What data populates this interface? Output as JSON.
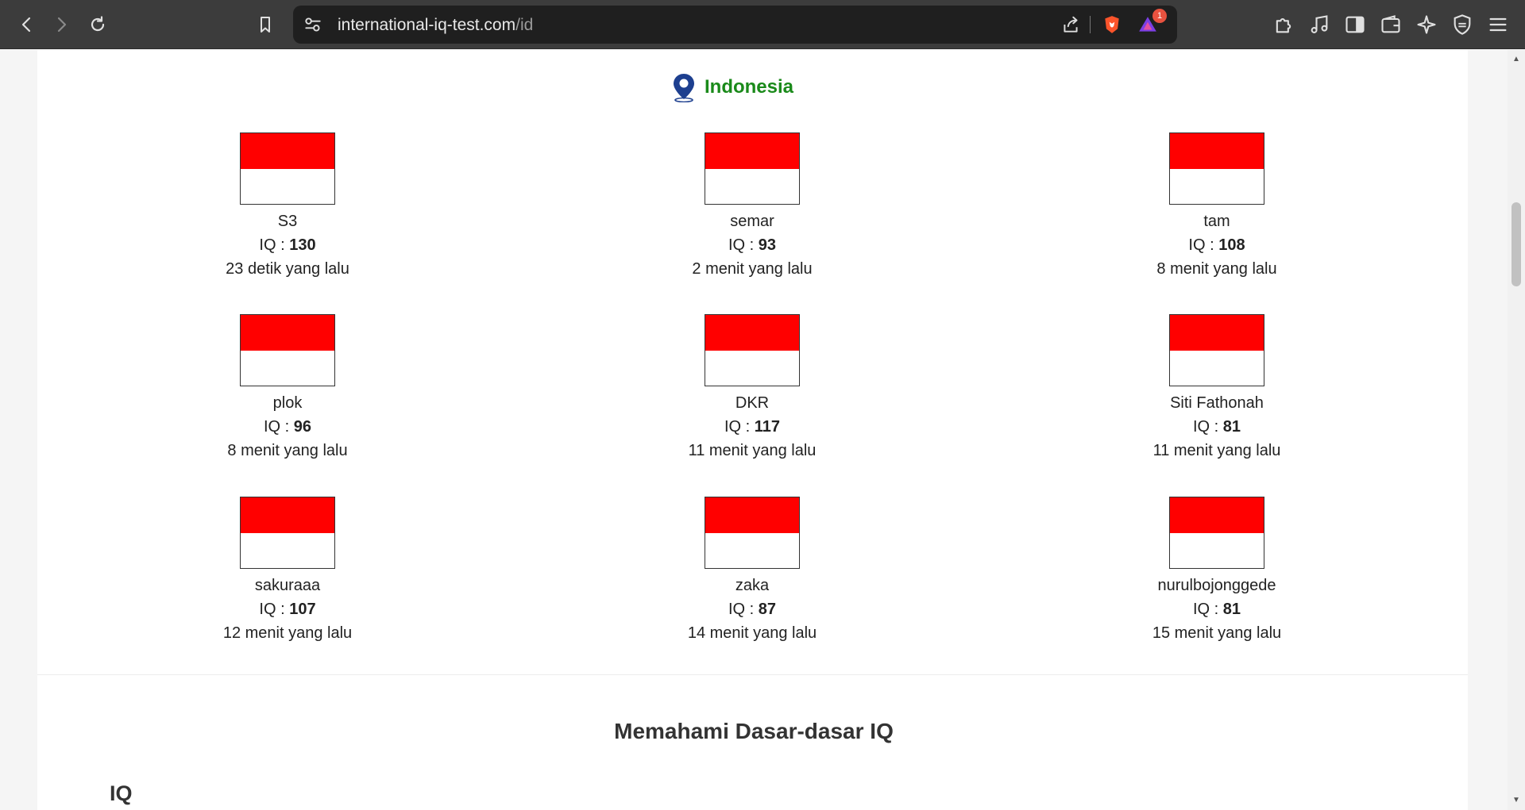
{
  "browser": {
    "url_host": "international-iq-test.com",
    "url_path": "/id",
    "notification_count": "1"
  },
  "country": {
    "label": "Indonesia",
    "icon": "map-pin-icon"
  },
  "entries": [
    {
      "name": "S3",
      "iq_prefix": "IQ : ",
      "iq": "130",
      "time": "23 detik yang lalu"
    },
    {
      "name": "semar",
      "iq_prefix": "IQ : ",
      "iq": "93",
      "time": "2 menit yang lalu"
    },
    {
      "name": "tam",
      "iq_prefix": "IQ : ",
      "iq": "108",
      "time": "8 menit yang lalu"
    },
    {
      "name": "plok",
      "iq_prefix": "IQ : ",
      "iq": "96",
      "time": "8 menit yang lalu"
    },
    {
      "name": "DKR",
      "iq_prefix": "IQ : ",
      "iq": "117",
      "time": "11 menit yang lalu"
    },
    {
      "name": "Siti Fathonah",
      "iq_prefix": "IQ : ",
      "iq": "81",
      "time": "11 menit yang lalu"
    },
    {
      "name": "sakuraaa",
      "iq_prefix": "IQ : ",
      "iq": "107",
      "time": "12 menit yang lalu"
    },
    {
      "name": "zaka",
      "iq_prefix": "IQ : ",
      "iq": "87",
      "time": "14 menit yang lalu"
    },
    {
      "name": "nurulbojonggede",
      "iq_prefix": "IQ : ",
      "iq": "81",
      "time": "15 menit yang lalu"
    }
  ],
  "section": {
    "title": "Memahami Dasar-dasar IQ",
    "subtitle": "IQ"
  },
  "colors": {
    "flag_red": "#ff0000",
    "country_green": "#1a8a1a"
  }
}
